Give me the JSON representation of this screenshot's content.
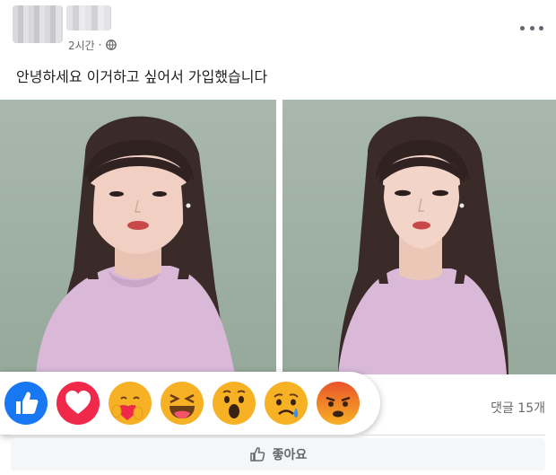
{
  "post": {
    "timestamp": "2시간",
    "privacy_icon": "globe-icon",
    "text": "안녕하세요 이거하고 싶어서 가입했습니다",
    "more_icon": "more-options-icon"
  },
  "photos": [
    {
      "name": "original-photo"
    },
    {
      "name": "edited-photo"
    }
  ],
  "reactions": [
    {
      "name": "like-reaction",
      "icon": "thumbs-up-icon",
      "color": "#1877f2"
    },
    {
      "name": "love-reaction",
      "icon": "heart-icon",
      "color": "#f02849"
    },
    {
      "name": "care-reaction",
      "icon": "hug-face-icon",
      "color": "#f7b125"
    },
    {
      "name": "haha-reaction",
      "icon": "laughing-face-icon",
      "color": "#f7b125"
    },
    {
      "name": "wow-reaction",
      "icon": "surprised-face-icon",
      "color": "#f7b125"
    },
    {
      "name": "sad-reaction",
      "icon": "crying-face-icon",
      "color": "#f7b125"
    },
    {
      "name": "angry-reaction",
      "icon": "angry-face-icon",
      "color": "#e9710f"
    }
  ],
  "footer": {
    "comments_label": "댓글 15개",
    "like_label": "좋아요",
    "like_icon": "thumbs-up-outline-icon"
  }
}
